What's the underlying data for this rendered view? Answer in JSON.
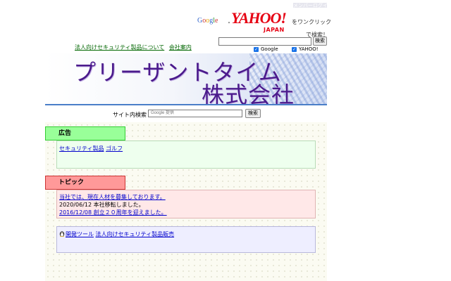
{
  "header": {
    "member_login": "メンバーログイン",
    "google_letters": [
      "G",
      "o",
      "o",
      "g",
      "l",
      "e"
    ],
    "separator": "・",
    "yahoo_word": "YAHOO!",
    "yahoo_sub": "JAPAN",
    "one_click": "をワンクリック",
    "search_label": "で検索！",
    "search_input_value": "",
    "search_button": "検索",
    "engines": [
      {
        "label": "Google",
        "checked": true
      },
      {
        "label": "YAHOO!",
        "checked": true
      }
    ]
  },
  "nav": {
    "links": [
      "法人向けセキュリティ製品について",
      "会社案内"
    ]
  },
  "banner": {
    "title_line1": "プリーザントタイム",
    "title_line2": "株式会社"
  },
  "site_search": {
    "label": "サイト内検索",
    "placeholder": "Google 提供",
    "button": "検索"
  },
  "sections": {
    "ads": {
      "heading": "広告",
      "links": [
        "セキュリティ製品",
        "ゴルフ"
      ]
    },
    "topics": {
      "heading": "トピック",
      "items": [
        {
          "text": "当社では、現在人材を募集しております。",
          "link": true
        },
        {
          "text": "2020/06/12 本社移転しました。",
          "link": false
        },
        {
          "text": "2016/12/08 創立２０周年を迎えました。",
          "link": true
        }
      ]
    },
    "products": {
      "links": [
        "開発ツール",
        "法人向けセキュリティ製品販売"
      ]
    }
  },
  "colors": {
    "accent_green": "#99ff99",
    "accent_pink": "#ff9999",
    "banner_purple": "#4b1a8c",
    "link_blue": "#0000cc"
  }
}
